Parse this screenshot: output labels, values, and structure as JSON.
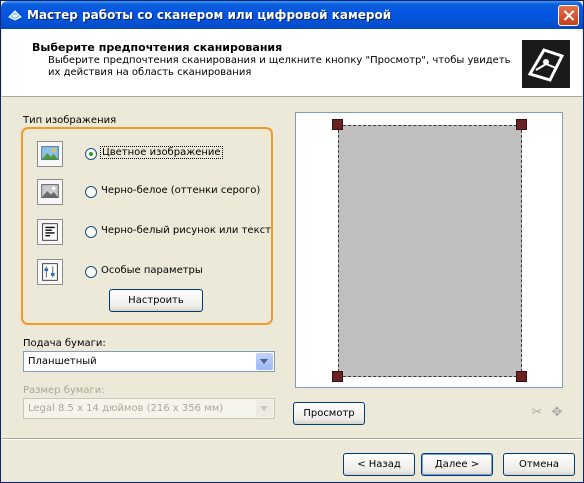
{
  "window": {
    "title": "Мастер работы со сканером или цифровой камерой"
  },
  "header": {
    "title": "Выберите предпочтения сканирования",
    "description": "Выберите предпочтения сканирования и щелкните кнопку \"Просмотр\", чтобы увидеть их действия на область сканирования"
  },
  "image_type": {
    "group_label": "Тип изображения",
    "options": [
      {
        "label": "Цветное изображение",
        "icon": "color-photo-icon",
        "selected": true
      },
      {
        "label": "Черно-белое (оттенки серого)",
        "icon": "grayscale-photo-icon",
        "selected": false
      },
      {
        "label": "Черно-белый рисунок или текст",
        "icon": "bw-text-icon",
        "selected": false
      },
      {
        "label": "Особые параметры",
        "icon": "custom-settings-icon",
        "selected": false
      }
    ],
    "configure_button": "Настроить"
  },
  "paper_source": {
    "label": "Подача бумаги:",
    "value": "Планшетный"
  },
  "paper_size": {
    "label": "Размер бумаги:",
    "value": "Legal 8.5 x 14 дюймов (216 x 356 мм)"
  },
  "preview": {
    "button": "Просмотр"
  },
  "footer": {
    "back": "< Назад",
    "next": "Далее >",
    "cancel": "Отмена"
  },
  "colors": {
    "accent_border": "#f39a27",
    "titlebar": "#0554e3",
    "preview_area": "#bfbfbf",
    "crop_handle": "#6a2222"
  }
}
